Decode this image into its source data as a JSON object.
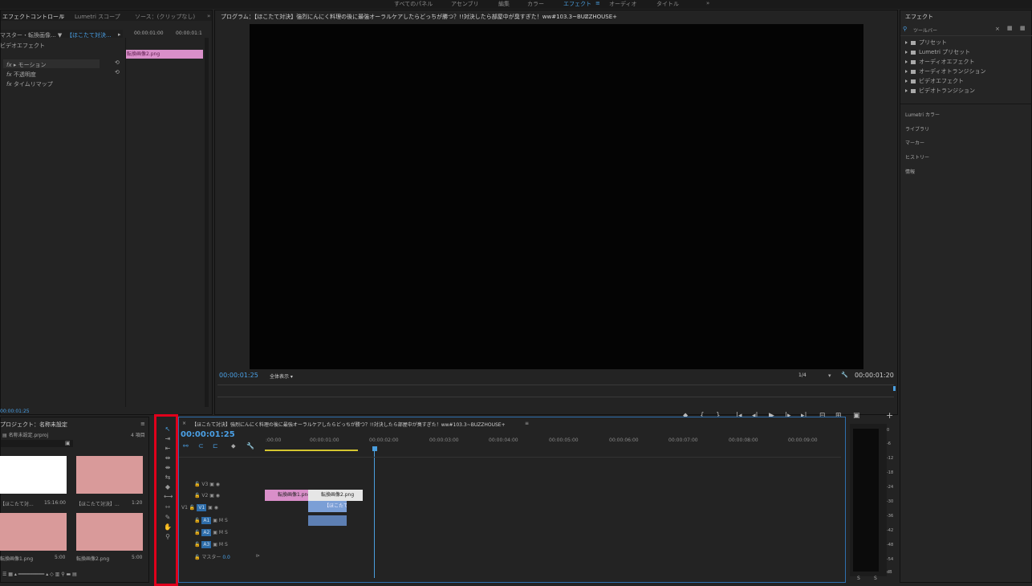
{
  "workspaces": [
    "すべてのパネル",
    "アセンブリ",
    "編集",
    "カラー",
    "エフェクト",
    "≡",
    "オーディオ",
    "タイトル",
    "»"
  ],
  "effect_controls": {
    "tabs": [
      "エフェクトコントロール",
      "≡",
      "Lumetri スコープ",
      "ソース：(クリップなし)",
      "»"
    ],
    "master": "マスター・転換画像... ▼",
    "sequence": "【ほこたて対決...",
    "tc_start": "00:00:01:00",
    "tc_end": "00:00:01:1",
    "clip_label": "転換画像2.png",
    "section": "ビデオエフェクト",
    "items": [
      "モーション",
      "不透明度",
      "タイムリマップ"
    ],
    "fx": "fx",
    "timecode": "00:00:01:25"
  },
  "program": {
    "title": "プログラム：【ほこたて対決】強烈にんにく料理の後に最強オーラルケアしたらどっちが勝つ？!!対決したら部屋中が臭すぎた！ww#103.3~BUZZHOUSE+",
    "menu": "≡",
    "timecode": "00:00:01:25",
    "fit": "全体表示",
    "resolution": "1/4",
    "duration": "00:00:01:20",
    "controls": [
      "⬥",
      "{",
      "}",
      "|◂",
      "◂|",
      "▶",
      "|▸",
      "▸|",
      "⊟",
      "⊞",
      "▣"
    ],
    "plus": "+"
  },
  "effects_panel": {
    "title": "エフェクト",
    "menu": "≡",
    "search_placeholder": "ツールバー",
    "items": [
      "プリセット",
      "Lumetri プリセット",
      "オーディオエフェクト",
      "オーディオトランジション",
      "ビデオエフェクト",
      "ビデオトランジション"
    ],
    "sections": [
      "Lumetri カラー",
      "ライブラリ",
      "マーカー",
      "ヒストリー",
      "情報"
    ]
  },
  "project": {
    "title": "プロジェクト：名称未設定",
    "menu": "≡",
    "file": "名称未設定.prproj",
    "count": "4 項目",
    "items": [
      {
        "name": "【ほこたて対...",
        "duration": "15:16:00"
      },
      {
        "name": "【ほこたて対決】...",
        "duration": "1:20"
      },
      {
        "name": "転換画像1.png",
        "duration": "5:00"
      },
      {
        "name": "転換画像2.png",
        "duration": "5:00"
      }
    ]
  },
  "timeline": {
    "close": "×",
    "title": "【ほこたて対決】強烈にんにく料理の後に最強オーラルケアしたらどっちが勝つ？!!対決したら部屋中が臭すぎた！ww#103.3~BUZZHOUSE+",
    "menu": "≡",
    "timecode": "00:00:01:25",
    "ruler": [
      ":00:00",
      "00:00:01:00",
      "00:00:02:00",
      "00:00:03:00",
      "00:00:04:00",
      "00:00:05:00",
      "00:00:06:00",
      "00:00:07:00",
      "00:00:08:00",
      "00:00:09:00"
    ],
    "tracks": [
      "V3",
      "V2",
      "V1",
      "A1",
      "A2",
      "A3"
    ],
    "source_patch": "V1",
    "master_label": "マスター",
    "master_value": "0.0",
    "clips": [
      "転換画像1.png",
      "転換画像2.png",
      "【ほこたて"
    ],
    "meter_labels": [
      "0",
      "-6",
      "-12",
      "-18",
      "-24",
      "-30",
      "-36",
      "-42",
      "-48",
      "-54",
      "dB"
    ],
    "meter_solo": [
      "S",
      "S"
    ]
  },
  "colors": {
    "accent": "#4a9ede",
    "highlight": "#e0001b",
    "clip_pink": "#d98fc9",
    "clip_blue": "#7b9fd6"
  }
}
